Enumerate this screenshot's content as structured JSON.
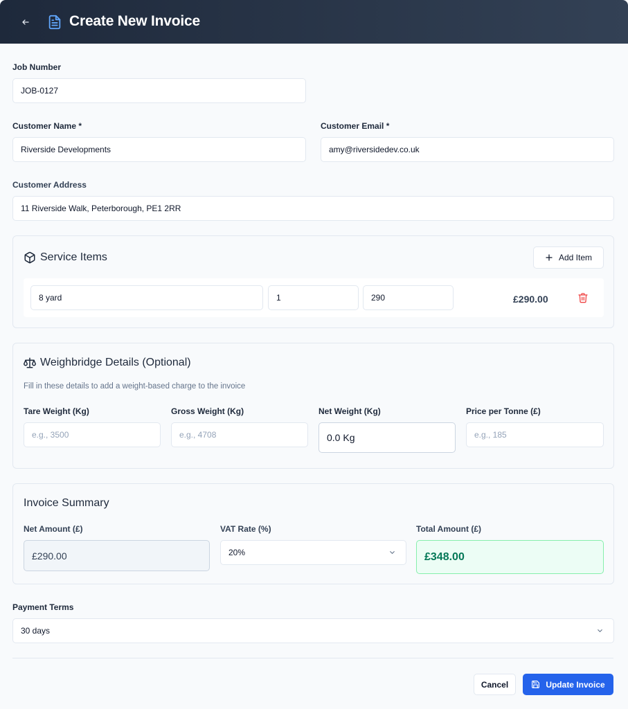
{
  "header": {
    "title": "Create New Invoice",
    "back_icon": "arrow-left-icon",
    "title_icon": "file-text-icon"
  },
  "job": {
    "label": "Job Number",
    "value": "JOB-0127"
  },
  "customer": {
    "name_label": "Customer Name *",
    "name_value": "Riverside Developments",
    "email_label": "Customer Email *",
    "email_value": "amy@riversidedev.co.uk",
    "address_label": "Customer Address",
    "address_value": "11 Riverside Walk, Peterborough, PE1 2RR"
  },
  "service_items": {
    "title": "Service Items",
    "add_label": "Add Item",
    "items": [
      {
        "description": "8 yard",
        "quantity": "1",
        "price": "290",
        "total": "£290.00"
      }
    ]
  },
  "weighbridge": {
    "title": "Weighbridge Details (Optional)",
    "hint": "Fill in these details to add a weight-based charge to the invoice",
    "tare_label": "Tare Weight (Kg)",
    "tare_placeholder": "e.g., 3500",
    "gross_label": "Gross Weight (Kg)",
    "gross_placeholder": "e.g., 4708",
    "net_label": "Net Weight (Kg)",
    "net_value": "0.0 Kg",
    "price_label": "Price per Tonne (£)",
    "price_placeholder": "e.g., 185"
  },
  "summary": {
    "title": "Invoice Summary",
    "net_label": "Net Amount (£)",
    "net_value": "£290.00",
    "vat_label": "VAT Rate (%)",
    "vat_value": "20%",
    "total_label": "Total Amount (£)",
    "total_value": "£348.00"
  },
  "payment": {
    "label": "Payment Terms",
    "value": "30 days"
  },
  "actions": {
    "cancel_label": "Cancel",
    "submit_label": "Update Invoice"
  },
  "colors": {
    "header": "#1e293b",
    "accent": "#2563eb",
    "total_bg": "#ecfdf5",
    "total_text": "#047857",
    "danger": "#ef4444"
  }
}
